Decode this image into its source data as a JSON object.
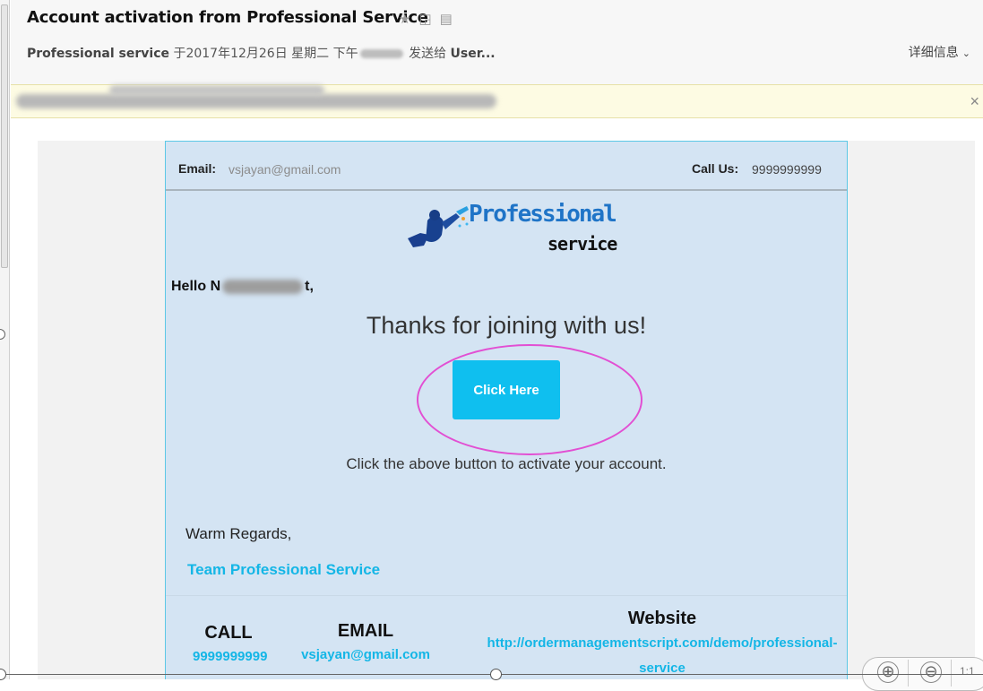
{
  "email": {
    "subject": "Account activation from Professional Service",
    "icons": [
      "star-icon",
      "popout-icon",
      "print-icon"
    ],
    "sender": "Professional service",
    "date_prefix": "于2017年12月26日 星期二 下午",
    "sent_to": "发送给",
    "recipient": "User...",
    "details_label": "详细信息"
  },
  "notice": {
    "close_glyph": "×"
  },
  "message": {
    "email_label": "Email:",
    "email_value": "vsjayan@gmail.com",
    "call_label": "Call Us:",
    "call_value": "9999999999",
    "logo_text_1": "Professional",
    "logo_text_2": "service",
    "hello_prefix": "Hello N",
    "hello_suffix": "t,",
    "thanks": "Thanks for joining with us!",
    "button_label": "Click Here",
    "instruction": "Click the above button to activate your account.",
    "regards": "Warm Regards,",
    "team": "Team Professional Service",
    "footer": {
      "call_title": "CALL",
      "call_value": "9999999999",
      "email_title": "EMAIL",
      "email_value": "vsjayan@gmail.com",
      "web_title": "Website",
      "web_value": "http://ordermanagementscript.com/demo/professional-service"
    }
  },
  "viewer": {
    "zoom_in": "⊕",
    "zoom_out": "⊖",
    "zoom_label": "1:1"
  },
  "colors": {
    "accent": "#0fbfef",
    "card_bg": "#d4e4f3",
    "highlight_ring": "#e24fd3",
    "link": "#14b6e6"
  }
}
